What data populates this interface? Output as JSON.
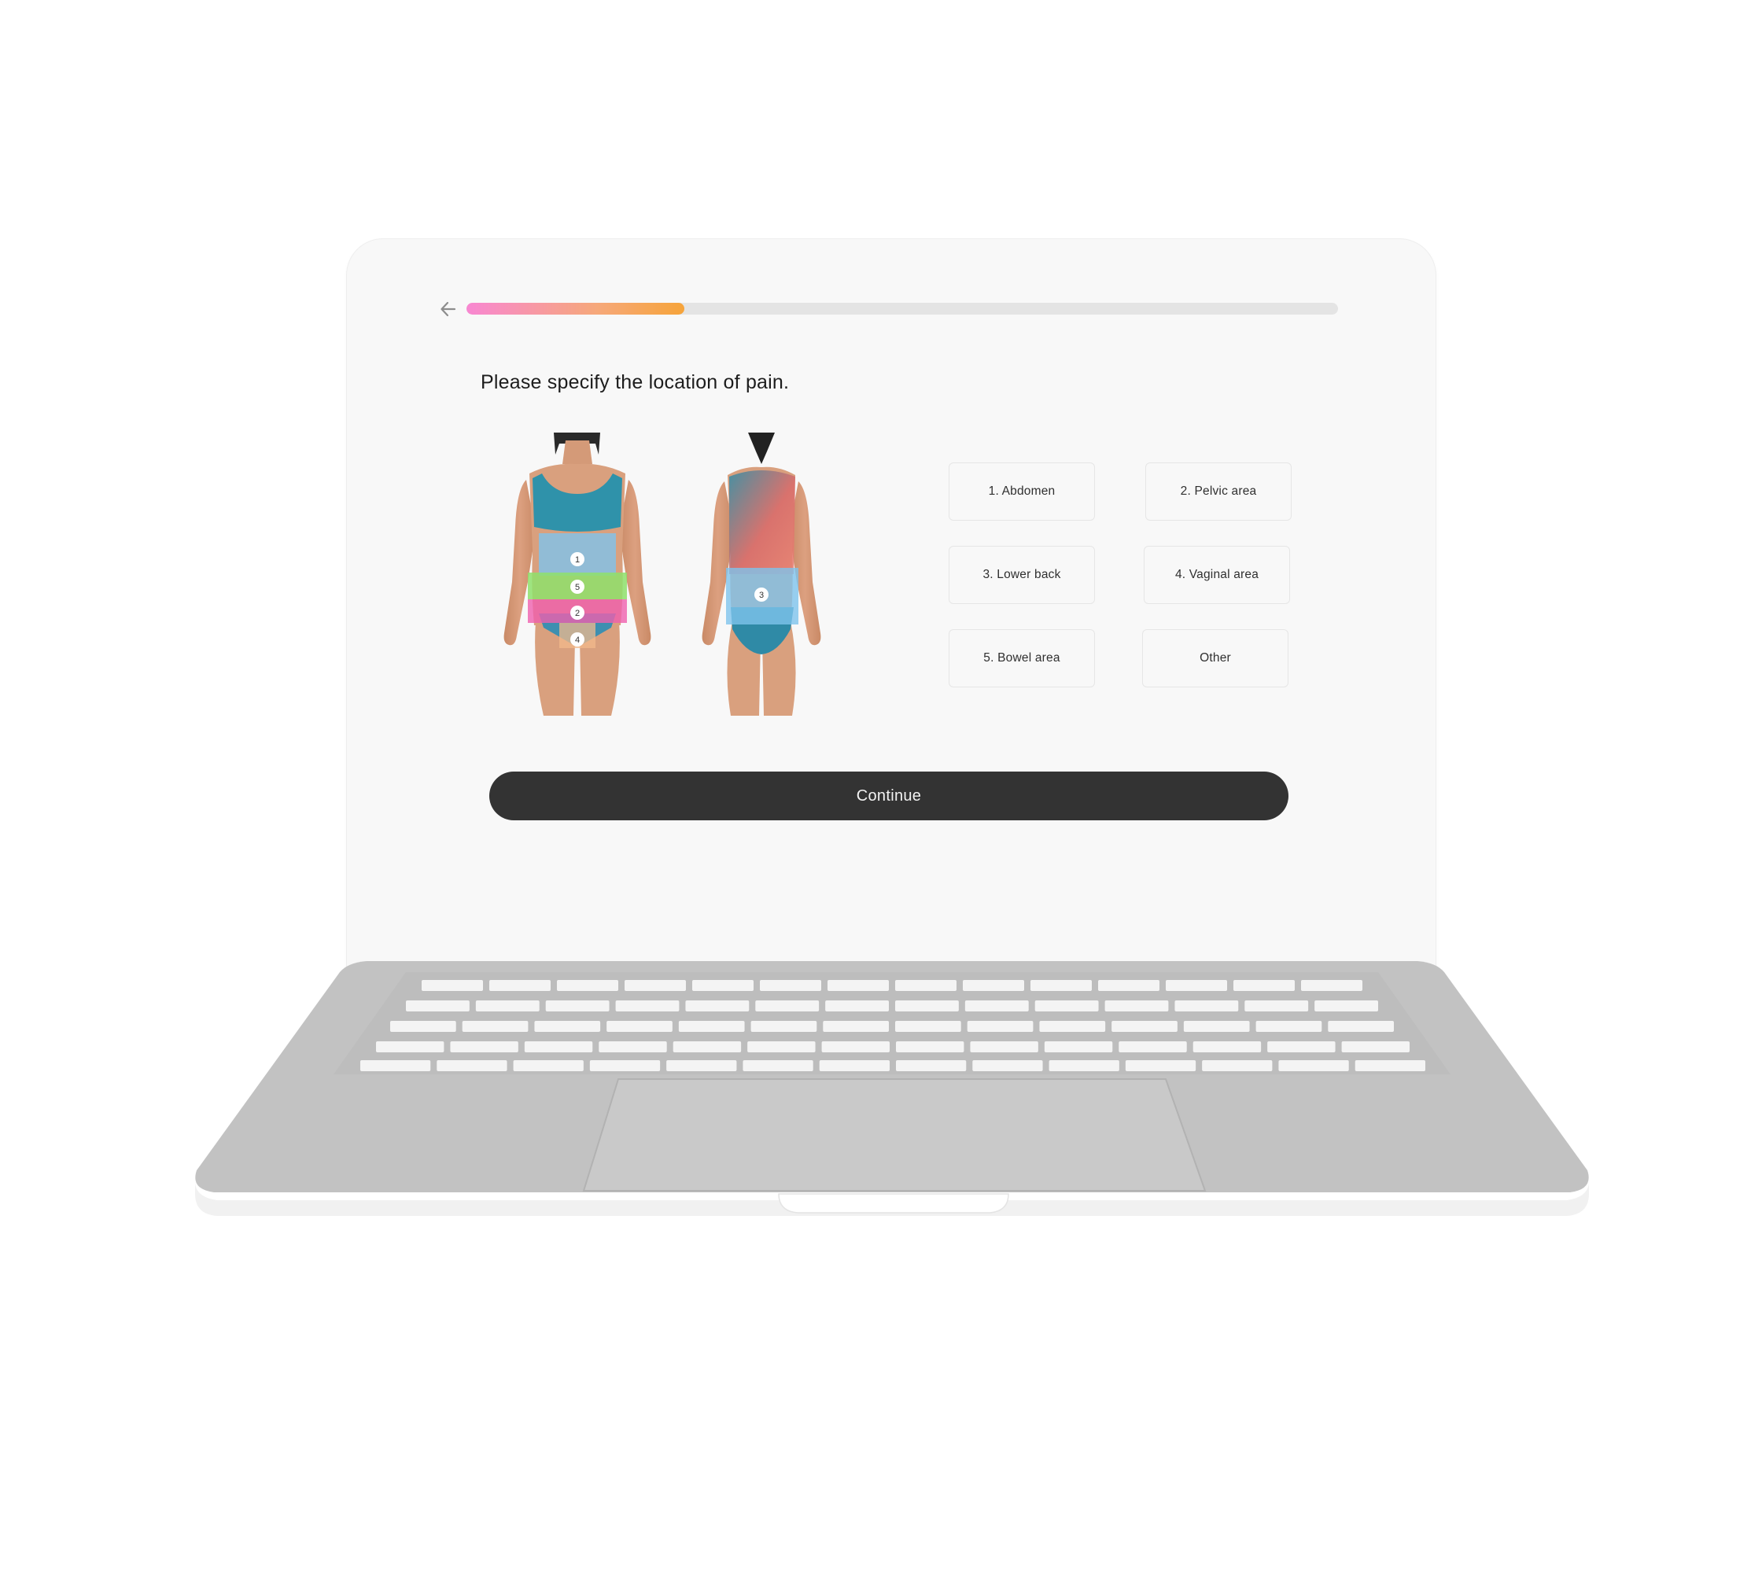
{
  "progress": {
    "fraction": 0.25,
    "colors": [
      "#f887d2",
      "#f6a87a",
      "#f6a43a"
    ]
  },
  "question": "Please specify the location of pain.",
  "diagram": {
    "front_markers": [
      "1",
      "5",
      "2",
      "4"
    ],
    "back_markers": [
      "3"
    ],
    "zone_colors": {
      "abdomen": "#7ec3ec",
      "pelvic": "#ef5fae",
      "lower_back": "#7ec3ec",
      "vaginal": "#f2b98c",
      "bowel": "#8ee06b"
    }
  },
  "options": [
    {
      "label": "1. Abdomen"
    },
    {
      "label": "2. Pelvic area"
    },
    {
      "label": "3. Lower back"
    },
    {
      "label": "4. Vaginal area"
    },
    {
      "label": "5. Bowel area"
    },
    {
      "label": "Other"
    }
  ],
  "continue_label": "Continue",
  "icons": {
    "back": "arrow-left-icon"
  }
}
